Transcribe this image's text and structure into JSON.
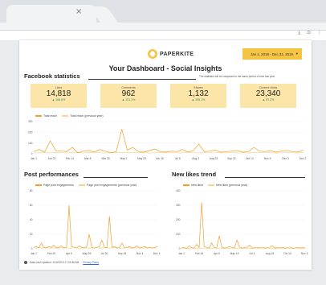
{
  "browser": {
    "tab_close_glyph": "×",
    "toolbar_icons": "⤓ ⊙ ⋮"
  },
  "report": {
    "brand": "PAPERKITE",
    "date_range": "Jan 1, 2019 - Dec 31, 2019",
    "title": "Your Dashboard - Social Insights"
  },
  "facebook": {
    "section_title": "Facebook statistics",
    "comparison_note": "The statistics will be compared to the same period of time last year",
    "kpis": [
      {
        "label": "Likes",
        "value": "14,818",
        "delta": "▲ 166.6%"
      },
      {
        "label": "Comments",
        "value": "962",
        "delta": "▲ 121.1%"
      },
      {
        "label": "Shares",
        "value": "1,132",
        "delta": "▲ 105.1%"
      },
      {
        "label": "Content clicks",
        "value": "23,340",
        "delta": "▲ 87.2%"
      }
    ],
    "reach_legend": [
      "Total reach",
      "Total reach (previous year)"
    ]
  },
  "post_performance": {
    "section_title": "Post performances",
    "legend": [
      "Page post engagements",
      "Page post engagements (previous year)"
    ]
  },
  "new_likes": {
    "section_title": "New likes trend",
    "legend": [
      "New likes",
      "New likes (previous year)"
    ]
  },
  "footer": {
    "updated": "Data Last Updated: 1/10/2019 17:23:36 AM ·",
    "policy": "Privacy Policy"
  },
  "colors": {
    "accent_yellow": "#f5c445",
    "kpi_bg": "#fbe5a9",
    "series_current": "#f0a030",
    "series_previous": "#fbd38a"
  },
  "chart_data": [
    {
      "type": "line",
      "title": "",
      "xlabel": "",
      "ylabel": "",
      "x_ticks": [
        "Jan 1",
        "Jan 23",
        "Feb 14",
        "Mar 8",
        "Mar 30",
        "May 1",
        "May 23",
        "Jun 16",
        "Jul 8",
        "Aug 3",
        "Aug 25",
        "Sep 22",
        "Oct 14",
        "Nov 5",
        "Dec 3",
        "Dec 27"
      ],
      "ylim": [
        0,
        300
      ],
      "y_ticks": [
        "300",
        "200",
        "100",
        "0"
      ],
      "series": [
        {
          "name": "Total reach",
          "values": [
            20,
            40,
            15,
            120,
            30,
            25,
            20,
            60,
            10,
            25,
            30,
            15,
            40,
            25,
            10,
            20,
            230,
            35,
            60,
            20,
            15,
            30,
            45,
            20,
            15,
            25,
            20,
            40,
            15,
            30,
            90,
            20,
            25,
            35,
            15,
            20,
            25,
            30,
            15,
            20,
            60,
            25,
            20,
            30,
            15,
            25,
            30,
            20,
            15,
            35
          ]
        },
        {
          "name": "Total reach (previous year)",
          "values": [
            8,
            10,
            12,
            9,
            11,
            10,
            8,
            12,
            10,
            9,
            11,
            12,
            10,
            8,
            9,
            11,
            10,
            12,
            9,
            10,
            11,
            8,
            10,
            12,
            9,
            11,
            10,
            9,
            12,
            10,
            8,
            11,
            10,
            9,
            12,
            10,
            11,
            8,
            10,
            9,
            12,
            10,
            11,
            9,
            10,
            8,
            12,
            10,
            9,
            11
          ]
        }
      ]
    },
    {
      "type": "line",
      "title": "",
      "xlabel": "",
      "ylabel": "",
      "x_ticks": [
        "Jan 1",
        "Feb 20",
        "Apr 5",
        "May 26",
        "Jul 20",
        "Sep 18",
        "Nov 4",
        "Dec 14"
      ],
      "ylim": [
        0,
        80
      ],
      "y_ticks": [
        "80",
        "60",
        "40",
        "20",
        "0"
      ],
      "series": [
        {
          "name": "Page post engagements",
          "values": [
            2,
            3,
            1,
            8,
            2,
            1,
            3,
            2,
            5,
            1,
            2,
            4,
            1,
            2,
            60,
            3,
            2,
            1,
            4,
            2,
            1,
            3,
            20,
            2,
            1,
            2,
            3,
            12,
            2,
            1,
            45,
            2,
            3,
            1,
            2,
            8,
            1,
            2,
            3,
            1,
            2,
            4,
            1,
            2,
            3,
            1,
            2,
            1,
            2,
            3
          ]
        },
        {
          "name": "Page post engagements (previous year)",
          "values": [
            1,
            1,
            2,
            1,
            1,
            2,
            1,
            1,
            1,
            2,
            1,
            1,
            2,
            1,
            1,
            1,
            2,
            1,
            1,
            1,
            2,
            1,
            1,
            1,
            1,
            2,
            1,
            1,
            1,
            2,
            1,
            1,
            2,
            1,
            1,
            1,
            1,
            2,
            1,
            1,
            1,
            2,
            1,
            1,
            1,
            1,
            2,
            1,
            1,
            1
          ]
        }
      ]
    },
    {
      "type": "line",
      "title": "",
      "xlabel": "",
      "ylabel": "",
      "x_ticks": [
        "Jan 1",
        "Feb 16",
        "Apr 5",
        "May 19",
        "Jul 4",
        "Aug 19",
        "Oct 14",
        "Nov 14"
      ],
      "ylim": [
        0,
        400
      ],
      "y_ticks": [
        "400",
        "300",
        "200",
        "100",
        "0"
      ],
      "series": [
        {
          "name": "New likes",
          "values": [
            5,
            10,
            3,
            20,
            8,
            5,
            30,
            10,
            320,
            15,
            10,
            5,
            40,
            8,
            10,
            90,
            12,
            5,
            8,
            15,
            10,
            6,
            60,
            12,
            5,
            8,
            10,
            25,
            5,
            8,
            10,
            6,
            12,
            5,
            8,
            10,
            20,
            5,
            8,
            6,
            10,
            5,
            8,
            12,
            5,
            6,
            10,
            5,
            8,
            6
          ]
        },
        {
          "name": "New likes (previous year)",
          "values": [
            2,
            3,
            2,
            3,
            2,
            2,
            3,
            2,
            3,
            2,
            2,
            3,
            2,
            2,
            3,
            2,
            3,
            2,
            2,
            3,
            2,
            2,
            3,
            2,
            3,
            2,
            2,
            3,
            2,
            2,
            3,
            2,
            3,
            2,
            2,
            3,
            2,
            2,
            3,
            2,
            3,
            2,
            2,
            3,
            2,
            2,
            3,
            2,
            3,
            2
          ]
        }
      ]
    }
  ]
}
